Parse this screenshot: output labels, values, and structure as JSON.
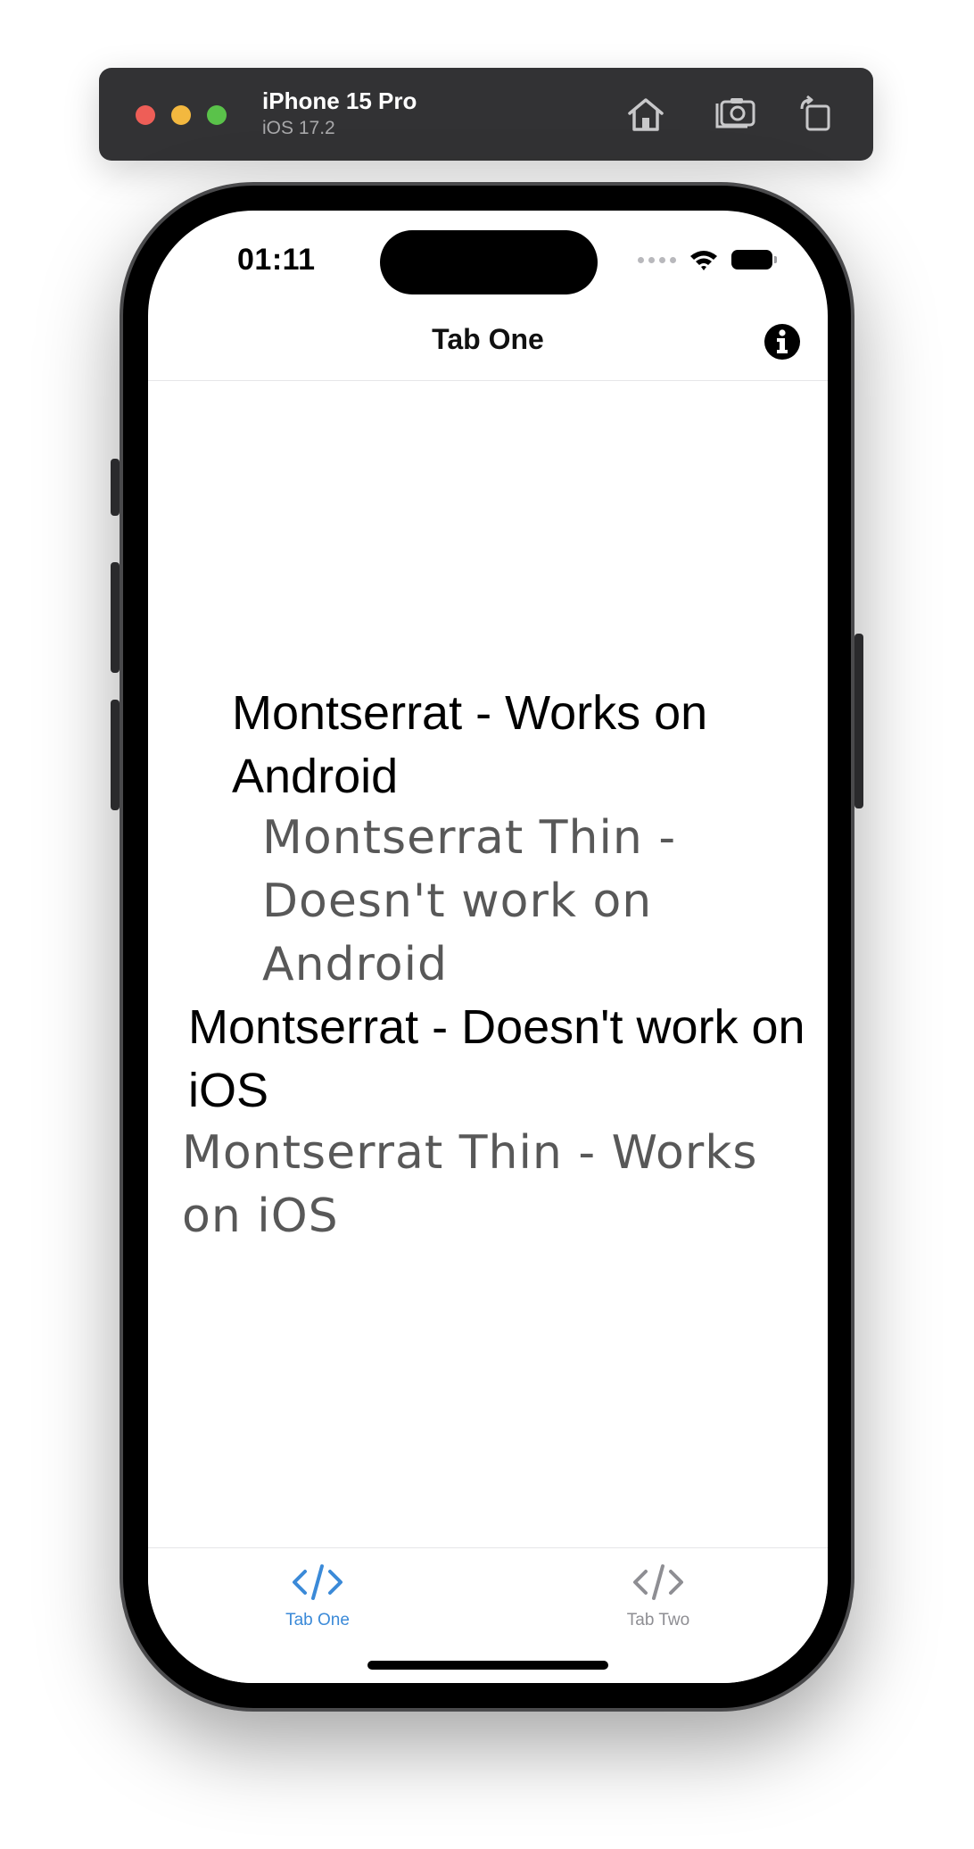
{
  "simulator": {
    "device_name": "iPhone 15 Pro",
    "os_version": "iOS 17.2",
    "buttons": [
      "home-icon",
      "screenshot-icon",
      "rotate-icon"
    ]
  },
  "status_bar": {
    "time": "01:11"
  },
  "nav": {
    "title": "Tab One",
    "info_icon": "info-circle-icon"
  },
  "content": {
    "lines": [
      "Montserrat - Works on Android",
      "Montserrat Thin - Doesn't work on Android",
      "Montserrat - Doesn't work on iOS",
      "Montserrat Thin - Works on iOS"
    ]
  },
  "tabs": [
    {
      "label": "Tab One",
      "icon": "code-icon",
      "active": true,
      "color": "#3b8ad8"
    },
    {
      "label": "Tab Two",
      "icon": "code-icon",
      "active": false,
      "color": "#8e8e93"
    }
  ]
}
